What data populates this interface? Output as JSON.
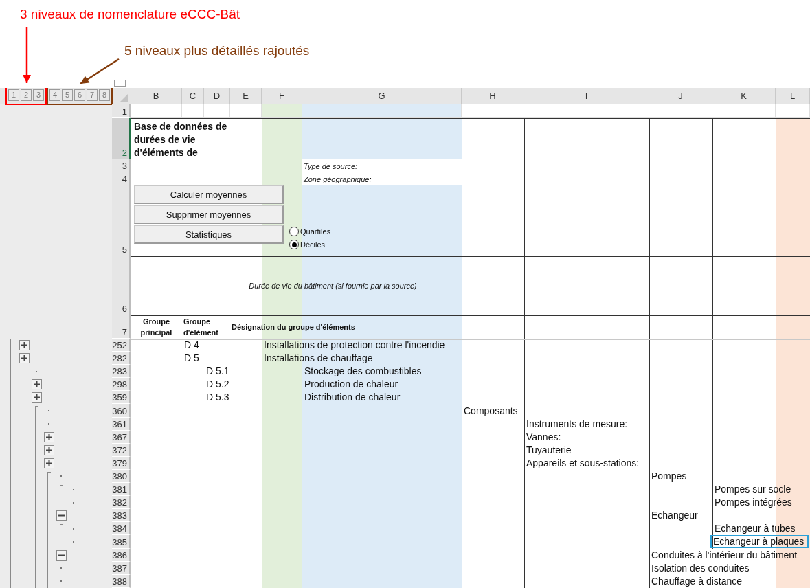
{
  "annotations": [
    {
      "text": "3 niveaux de nomenclature eCCC-Bât",
      "color": "#ff0000",
      "levels": [
        "1",
        "2",
        "3"
      ]
    },
    {
      "text": "5 niveaux plus détaillés rajoutés",
      "color": "#843c0c",
      "levels": [
        "4",
        "5",
        "6",
        "7",
        "8"
      ]
    }
  ],
  "column_headers": [
    "B",
    "C",
    "D",
    "E",
    "F",
    "G",
    "H",
    "I",
    "J",
    "K",
    "L"
  ],
  "header_rows": [
    {
      "number": "1",
      "selected": false
    },
    {
      "number": "2",
      "selected": true
    },
    {
      "number": "3",
      "selected": false
    },
    {
      "number": "4",
      "selected": false
    },
    {
      "number": "5",
      "selected": false
    },
    {
      "number": "6",
      "selected": false
    },
    {
      "number": "7",
      "selected": false
    }
  ],
  "title": "Base de données de durées de vie d'éléments de",
  "source_labels": [
    "Type de source:",
    "Zone géographique:"
  ],
  "buttons": [
    "Calculer moyennes",
    "Supprimer moyennes",
    "Statistiques"
  ],
  "options": [
    {
      "label": "Quartiles",
      "selected": false
    },
    {
      "label": "Déciles",
      "selected": true
    }
  ],
  "building_life_label": "Durée de vie du bâtiment (si fournie par la source)",
  "column_titles": [
    "Groupe principal",
    "Groupe d'élément",
    "Désignation du groupe d'éléments"
  ],
  "outline": [
    {
      "number": "252",
      "expanded": false,
      "cells": {
        "C": {
          "text": "D 4",
          "selected": false
        },
        "F": {
          "text": "Installations de protection contre l'incendie",
          "selected": false
        }
      }
    },
    {
      "number": "282",
      "expanded": false,
      "cells": {
        "C": {
          "text": "D 5",
          "selected": false
        },
        "F": {
          "text": "Installations de chauffage",
          "selected": false
        }
      }
    },
    {
      "children": [
        {
          "number": "283",
          "cells": {
            "D": {
              "text": "D 5.1",
              "selected": false
            },
            "G": {
              "text": "Stockage des combustibles",
              "selected": false
            }
          }
        },
        {
          "number": "298",
          "expanded": false,
          "cells": {
            "D": {
              "text": "D 5.2",
              "selected": false
            },
            "G": {
              "text": "Production de chaleur",
              "selected": false
            }
          }
        },
        {
          "number": "359",
          "expanded": false,
          "cells": {
            "D": {
              "text": "D 5.3",
              "selected": false
            },
            "G": {
              "text": "Distribution de chaleur",
              "selected": false
            }
          }
        },
        {
          "children": [
            {
              "number": "360",
              "cells": {
                "H": {
                  "text": "Composants",
                  "selected": false
                }
              }
            },
            {
              "number": "361",
              "cells": {
                "I": {
                  "text": "Instruments de mesure:",
                  "selected": false
                }
              }
            },
            {
              "number": "367",
              "expanded": false,
              "cells": {
                "I": {
                  "text": "Vannes:",
                  "selected": false
                }
              }
            },
            {
              "number": "372",
              "expanded": false,
              "cells": {
                "I": {
                  "text": "Tuyauterie",
                  "selected": false
                }
              }
            },
            {
              "number": "379",
              "expanded": false,
              "cells": {
                "I": {
                  "text": "Appareils et sous-stations:",
                  "selected": false
                }
              }
            },
            {
              "children": [
                {
                  "number": "380",
                  "cells": {
                    "J": {
                      "text": "Pompes",
                      "selected": false
                    }
                  }
                },
                {
                  "number": "383",
                  "expanded": true,
                  "cells": {
                    "J": {
                      "text": "Echangeur",
                      "selected": false
                    }
                  },
                  "children": [
                    {
                      "number": "381",
                      "cells": {
                        "K": {
                          "text": "Pompes sur socle",
                          "selected": false
                        }
                      }
                    },
                    {
                      "number": "382",
                      "cells": {
                        "K": {
                          "text": "Pompes intégrées",
                          "selected": false
                        }
                      }
                    }
                  ]
                },
                {
                  "number": "386",
                  "expanded": true,
                  "cells": {
                    "J": {
                      "text": "Conduites à l'intérieur du bâtiment",
                      "selected": false
                    }
                  },
                  "children": [
                    {
                      "number": "384",
                      "cells": {
                        "K": {
                          "text": "Echangeur à tubes",
                          "selected": false
                        }
                      }
                    },
                    {
                      "number": "385",
                      "cells": {
                        "K": {
                          "text": "Echangeur à plaques",
                          "selected": true
                        }
                      }
                    }
                  ]
                },
                {
                  "number": "387",
                  "cells": {
                    "J": {
                      "text": "Isolation des conduites",
                      "selected": false
                    }
                  }
                },
                {
                  "number": "388",
                  "cells": {
                    "J": {
                      "text": "Chauffage à distance",
                      "selected": false
                    }
                  }
                }
              ]
            }
          ]
        }
      ]
    }
  ]
}
